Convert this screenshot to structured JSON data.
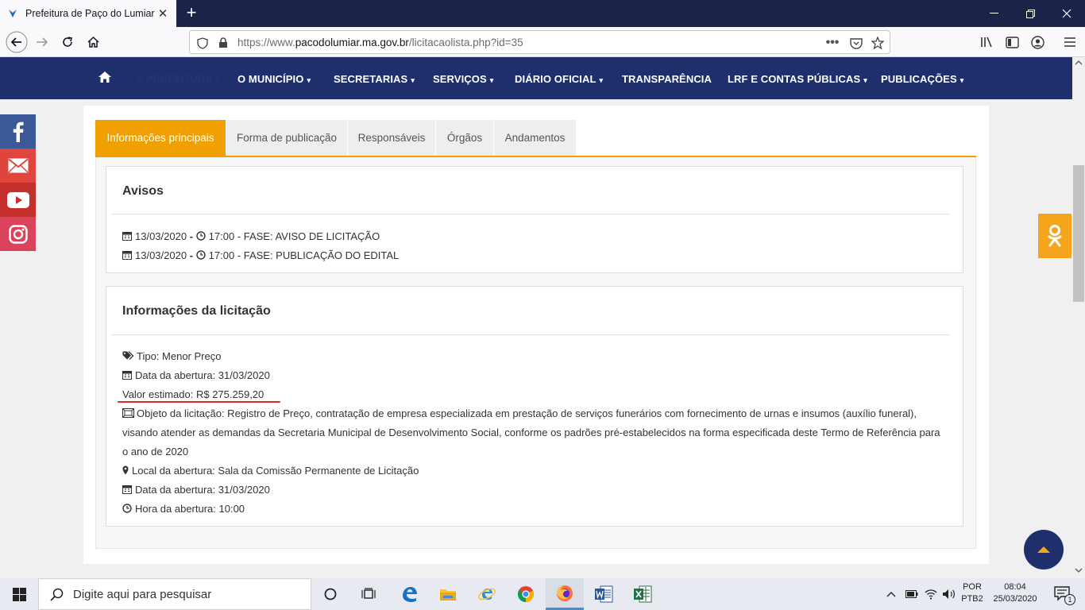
{
  "browser": {
    "tab_title": "Prefeitura de Paço do Lumiar",
    "url_prefix": "https://www.",
    "url_domain": "pacodolumiar.ma.gov.br",
    "url_path": "/licitacaolista.php?id=35"
  },
  "site_menu": {
    "items": [
      {
        "label": "A PREFEITURA",
        "has_dropdown": true
      },
      {
        "label": "O MUNICÍPIO",
        "has_dropdown": true
      },
      {
        "label": "SECRETARIAS",
        "has_dropdown": true
      },
      {
        "label": "SERVIÇOS",
        "has_dropdown": true
      },
      {
        "label": "DIÁRIO OFICIAL",
        "has_dropdown": true
      },
      {
        "label": "TRANSPARÊNCIA",
        "has_dropdown": false
      },
      {
        "label": "LRF E CONTAS PÚBLICAS",
        "has_dropdown": true
      },
      {
        "label": "PUBLICAÇÕES",
        "has_dropdown": true
      }
    ]
  },
  "tabs": [
    {
      "label": "Informações principais",
      "active": true
    },
    {
      "label": "Forma de publicação",
      "active": false
    },
    {
      "label": "Responsáveis",
      "active": false
    },
    {
      "label": "Órgãos",
      "active": false
    },
    {
      "label": "Andamentos",
      "active": false
    }
  ],
  "avisos": {
    "title": "Avisos",
    "entries": [
      {
        "date": "13/03/2020",
        "dash": " - ",
        "time": "17:00 - FASE: AVISO DE LICITAÇÃO"
      },
      {
        "date": "13/03/2020",
        "dash": " - ",
        "time": "17:00 - FASE: PUBLICAÇÃO DO EDITAL"
      }
    ]
  },
  "info": {
    "title": "Informações da licitação",
    "tipo": "Tipo: Menor Preço",
    "data_abertura": "Data da abertura: 31/03/2020",
    "valor": "Valor estimado: R$ 275.259,20",
    "objeto": "Objeto da licitação: Registro de Preço, contratação de empresa especializada em prestação de serviços funerários com fornecimento de urnas e insumos (auxílio funeral), visando atender as demandas da Secretaria Municipal de Desenvolvimento Social, conforme os padrões pré-estabelecidos na forma especificada deste Termo de Referência para o ano de 2020",
    "local": "Local da abertura: Sala da Comissão Permanente de Licitação",
    "data_abertura_2": "Data da abertura: 31/03/2020",
    "hora": "Hora da abertura: 10:00"
  },
  "taskbar": {
    "search_placeholder": "Digite aqui para pesquisar",
    "lang_top": "POR",
    "lang_bottom": "PTB2",
    "time": "08:04",
    "date": "25/03/2020",
    "notif_count": "1"
  },
  "colors": {
    "site_nav": "#1e2f6b",
    "accent": "#f0a000",
    "underline": "#d62b2b",
    "tab_bar": "#1b2448"
  }
}
